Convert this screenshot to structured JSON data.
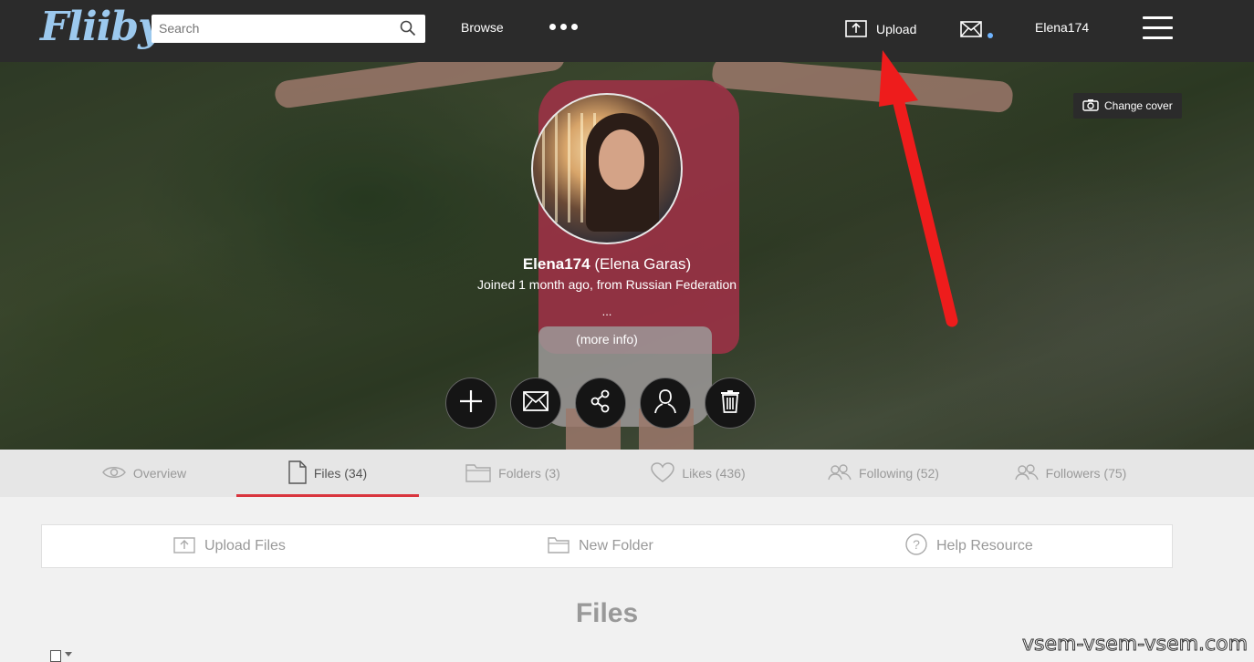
{
  "header": {
    "logo": "Fliiby",
    "search_placeholder": "Search",
    "browse_label": "Browse",
    "upload_label": "Upload",
    "username": "Elena174"
  },
  "cover": {
    "change_cover_label": "Change cover"
  },
  "profile": {
    "username": "Elena174",
    "full_name": "(Elena Garas)",
    "joined": "Joined 1 month ago, from Russian Federation",
    "bio": "...",
    "more_info": "(more info)"
  },
  "tabs": [
    {
      "label": "Overview",
      "icon": "eye-icon"
    },
    {
      "label": "Files (34)",
      "icon": "file-icon",
      "active": true
    },
    {
      "label": "Folders (3)",
      "icon": "folder-icon"
    },
    {
      "label": "Likes (436)",
      "icon": "heart-icon"
    },
    {
      "label": "Following (52)",
      "icon": "users-icon"
    },
    {
      "label": "Followers (75)",
      "icon": "users-icon"
    }
  ],
  "toolbar": {
    "upload_files": "Upload Files",
    "new_folder": "New Folder",
    "help_resource": "Help Resource"
  },
  "content": {
    "title": "Files"
  },
  "watermark": "vsem-vsem-vsem.com",
  "colors": {
    "topbar": "#2b2b2b",
    "accent_red": "#d9353e",
    "logo_blue": "#9cc9ee",
    "notify_dot": "#6fb4ff"
  }
}
